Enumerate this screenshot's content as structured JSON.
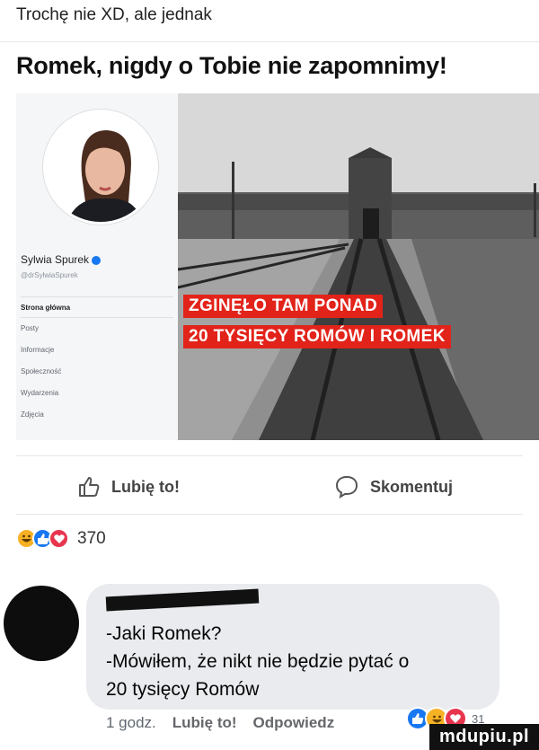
{
  "caption": "Trochę nie XD, ale jednak",
  "headline": "Romek, nigdy o Tobie nie zapomnimy!",
  "embedded_page": {
    "profile_name": "Sylwia Spurek",
    "profile_handle": "@drSylwiaSpurek",
    "menu": [
      "Strona główna",
      "Posty",
      "Informacje",
      "Społeczność",
      "Wydarzenia",
      "Zdjęcia"
    ],
    "banner_line1": "ZGINĘŁO TAM PONAD",
    "banner_line2": "20 TYSIĘCY ROMÓW I ROMEK",
    "banner_color": "#e2231a"
  },
  "actions": {
    "like_label": "Lubię to!",
    "comment_label": "Skomentuj"
  },
  "reactions": {
    "icons": [
      "laugh-icon",
      "like-icon",
      "love-icon"
    ],
    "count": "370"
  },
  "comment": {
    "text": "-Jaki Romek?\n-Mówiłem, że nikt nie będzie pytać o\n20 tysięcy Romów",
    "time": "1 godz.",
    "like_label": "Lubię to!",
    "reply_label": "Odpowiedz",
    "reaction_count": "31"
  },
  "watermark": "mdupiu.pl"
}
